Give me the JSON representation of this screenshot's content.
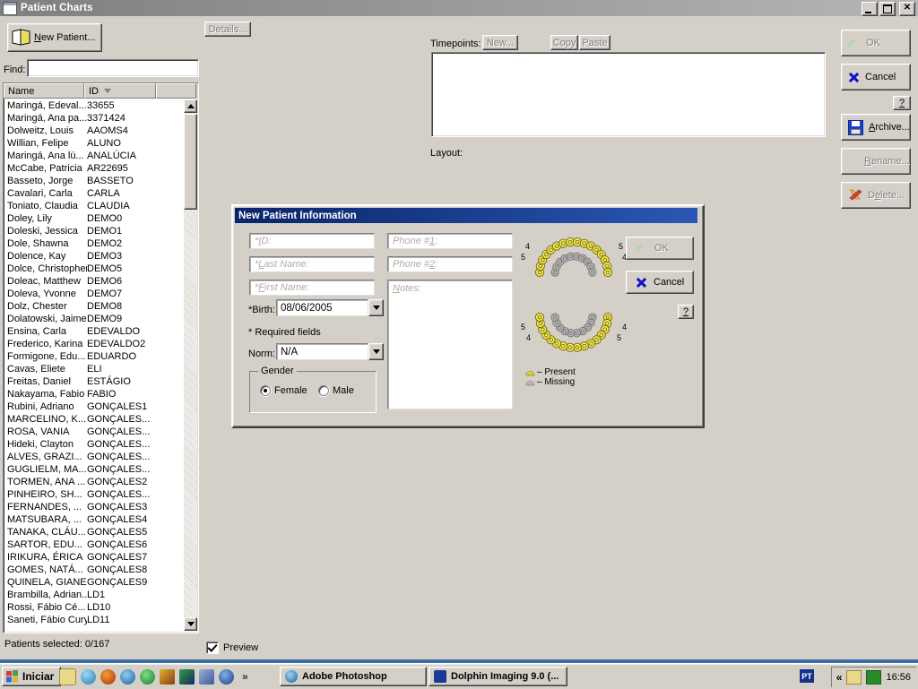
{
  "window": {
    "title": "Patient Charts",
    "titlebar_buttons": [
      "minimize",
      "maximize",
      "close"
    ]
  },
  "toolbar": {
    "new_patient_label": "New Patient...",
    "details_label": "Details..."
  },
  "find": {
    "label": "Find:",
    "value": "",
    "placeholder": ""
  },
  "patient_list": {
    "columns": [
      "Name",
      "ID",
      ""
    ],
    "sort_column": "ID",
    "sort_direction": "descending",
    "rows": [
      {
        "name": "Maringá, Edeval...",
        "id": "33655"
      },
      {
        "name": "Maringá, Ana pa...",
        "id": "3371424"
      },
      {
        "name": "Dolweitz, Louis",
        "id": "AAOMS4"
      },
      {
        "name": "Willian, Felipe",
        "id": "ALUNO"
      },
      {
        "name": "Maringá, Ana lú...",
        "id": "ANALÚCIA"
      },
      {
        "name": "McCabe, Patricia",
        "id": "AR22695"
      },
      {
        "name": "Basseto, Jorge",
        "id": "BASSETO"
      },
      {
        "name": "Cavalari, Carla",
        "id": "CARLA"
      },
      {
        "name": "Toniato, Claudia",
        "id": "CLAUDIA"
      },
      {
        "name": "Doley, Lily",
        "id": "DEMO0"
      },
      {
        "name": "Doleski, Jessica",
        "id": "DEMO1"
      },
      {
        "name": "Dole, Shawna",
        "id": "DEMO2"
      },
      {
        "name": "Dolence, Kay",
        "id": "DEMO3"
      },
      {
        "name": "Dolce, Christopher",
        "id": "DEMO5"
      },
      {
        "name": "Doleac, Matthew",
        "id": "DEMO6"
      },
      {
        "name": "Doleva, Yvonne",
        "id": "DEMO7"
      },
      {
        "name": "Dolz, Chester",
        "id": "DEMO8"
      },
      {
        "name": "Dolatowski, Jaime",
        "id": "DEMO9"
      },
      {
        "name": "Ensina, Carla",
        "id": "EDEVALDO"
      },
      {
        "name": "Frederico, Karina",
        "id": "EDEVALDO2"
      },
      {
        "name": "Formigone, Edu...",
        "id": "EDUARDO"
      },
      {
        "name": "Cavas, Eliete",
        "id": "ELI"
      },
      {
        "name": "Freitas, Daniel",
        "id": "ESTÁGIO"
      },
      {
        "name": "Nakayama, Fabio",
        "id": "FABIO"
      },
      {
        "name": "Rubini, Adriano",
        "id": "GONÇALES1"
      },
      {
        "name": "MARCELINO, K...",
        "id": "GONÇALES..."
      },
      {
        "name": "ROSA, VANIA",
        "id": "GONÇALES..."
      },
      {
        "name": "Hideki, Clayton",
        "id": "GONÇALES..."
      },
      {
        "name": "ALVES, GRAZI...",
        "id": "GONÇALES..."
      },
      {
        "name": "GUGLIELM, MA...",
        "id": "GONÇALES..."
      },
      {
        "name": "TORMEN, ANA ...",
        "id": "GONÇALES2"
      },
      {
        "name": "PINHEIRO, SH...",
        "id": "GONÇALES..."
      },
      {
        "name": "FERNANDES, ...",
        "id": "GONÇALES3"
      },
      {
        "name": "MATSUBARA, ...",
        "id": "GONÇALES4"
      },
      {
        "name": "TANAKA, CLÁU...",
        "id": "GONÇALES5"
      },
      {
        "name": "SARTOR, EDU...",
        "id": "GONÇALES6"
      },
      {
        "name": "IRIKURA, ÉRICA",
        "id": "GONÇALES7"
      },
      {
        "name": "GOMES, NATÁ...",
        "id": "GONÇALES8"
      },
      {
        "name": "QUINELA, GIANE",
        "id": "GONÇALES9"
      },
      {
        "name": "Brambilla, Adrian...",
        "id": "LD1"
      },
      {
        "name": "Rossi, Fábio Cé...",
        "id": "LD10"
      },
      {
        "name": "Saneti, Fábio Cury",
        "id": "LD11"
      }
    ]
  },
  "status": {
    "patients_selected": "Patients selected: 0/167",
    "preview_label": "Preview",
    "preview_checked": true
  },
  "timepoints": {
    "label": "Timepoints:",
    "new_label": "New...",
    "copy_label": "Copy",
    "paste_label": "Paste",
    "items": []
  },
  "layout": {
    "label": "Layout:"
  },
  "right_panel": {
    "ok_label": "OK",
    "cancel_label": "Cancel",
    "help_label": "?",
    "archive_label": "Archive...",
    "rename_label": "Rename...",
    "delete_label": "Delete..."
  },
  "dialog": {
    "title": "New Patient Information",
    "fields": {
      "id_placeholder": "*ID:",
      "last_name_placeholder": "*Last Name:",
      "first_name_placeholder": "*First Name:",
      "phone1_placeholder": "Phone #1:",
      "phone2_placeholder": "Phone #2:",
      "notes_placeholder": "Notes:"
    },
    "birth_label": "*Birth:",
    "birth_value": "08/06/2005",
    "required_note": "* Required fields",
    "norm_label": "Norm:",
    "norm_value": "N/A",
    "gender_legend": "Gender",
    "gender_female": "Female",
    "gender_male": "Male",
    "gender_selected": "Female",
    "legend_present": "– Present",
    "legend_missing": "– Missing",
    "ok_label": "OK",
    "cancel_label": "Cancel",
    "help_label": "?",
    "tooth_numbers": [
      "4",
      "5",
      "5",
      "4",
      "5",
      "4",
      "4",
      "5"
    ],
    "colors": {
      "present": "#f2e85c",
      "missing": "#b8b8b8",
      "titlebar": "#0a246a",
      "dialog_face": "#d4d0c8"
    }
  },
  "taskbar": {
    "start_label": "Iniciar",
    "quicklaunch_overflow": "»",
    "tasks": [
      {
        "label": "Adobe Photoshop"
      },
      {
        "label": "Dolphin Imaging 9.0 (..."
      }
    ],
    "language": "PT",
    "tray_overflow": "«",
    "clock": "16:56"
  }
}
